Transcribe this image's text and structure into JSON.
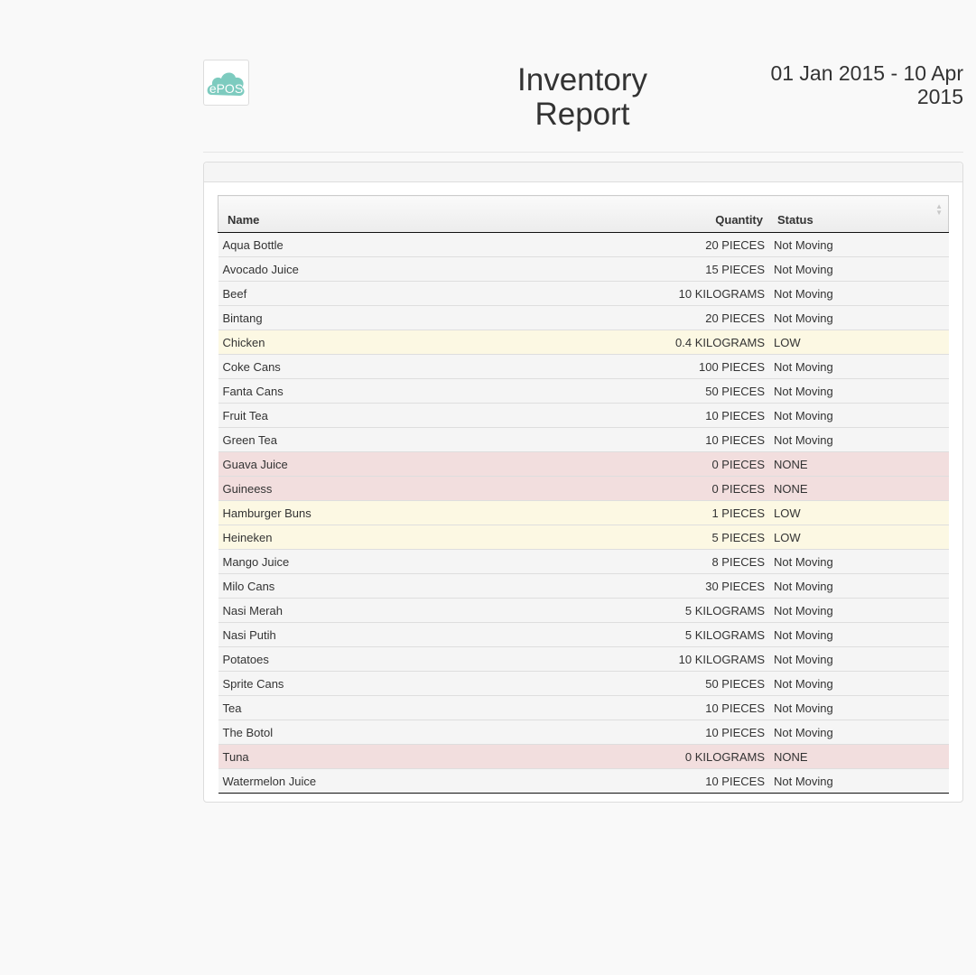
{
  "header": {
    "logo_text": "ePOS",
    "title": "Inventory Report",
    "date_range": "01 Jan 2015 - 10 Apr 2015"
  },
  "table": {
    "columns": {
      "name": "Name",
      "quantity": "Quantity",
      "status": "Status"
    },
    "sort": {
      "column": "name",
      "direction": "asc"
    },
    "rows": [
      {
        "name": "Aqua Bottle",
        "quantity": "20 PIECES",
        "status": "Not Moving",
        "level": "normal"
      },
      {
        "name": "Avocado Juice",
        "quantity": "15 PIECES",
        "status": "Not Moving",
        "level": "normal"
      },
      {
        "name": "Beef",
        "quantity": "10 KILOGRAMS",
        "status": "Not Moving",
        "level": "normal"
      },
      {
        "name": "Bintang",
        "quantity": "20 PIECES",
        "status": "Not Moving",
        "level": "normal"
      },
      {
        "name": "Chicken",
        "quantity": "0.4 KILOGRAMS",
        "status": "LOW",
        "level": "low"
      },
      {
        "name": "Coke Cans",
        "quantity": "100 PIECES",
        "status": "Not Moving",
        "level": "normal"
      },
      {
        "name": "Fanta Cans",
        "quantity": "50 PIECES",
        "status": "Not Moving",
        "level": "normal"
      },
      {
        "name": "Fruit Tea",
        "quantity": "10 PIECES",
        "status": "Not Moving",
        "level": "normal"
      },
      {
        "name": "Green Tea",
        "quantity": "10 PIECES",
        "status": "Not Moving",
        "level": "normal"
      },
      {
        "name": "Guava Juice",
        "quantity": "0 PIECES",
        "status": "NONE",
        "level": "none"
      },
      {
        "name": "Guineess",
        "quantity": "0 PIECES",
        "status": "NONE",
        "level": "none"
      },
      {
        "name": "Hamburger Buns",
        "quantity": "1 PIECES",
        "status": "LOW",
        "level": "low"
      },
      {
        "name": "Heineken",
        "quantity": "5 PIECES",
        "status": "LOW",
        "level": "low"
      },
      {
        "name": "Mango Juice",
        "quantity": "8 PIECES",
        "status": "Not Moving",
        "level": "normal"
      },
      {
        "name": "Milo Cans",
        "quantity": "30 PIECES",
        "status": "Not Moving",
        "level": "normal"
      },
      {
        "name": "Nasi Merah",
        "quantity": "5 KILOGRAMS",
        "status": "Not Moving",
        "level": "normal"
      },
      {
        "name": "Nasi Putih",
        "quantity": "5 KILOGRAMS",
        "status": "Not Moving",
        "level": "normal"
      },
      {
        "name": "Potatoes",
        "quantity": "10 KILOGRAMS",
        "status": "Not Moving",
        "level": "normal"
      },
      {
        "name": "Sprite Cans",
        "quantity": "50 PIECES",
        "status": "Not Moving",
        "level": "normal"
      },
      {
        "name": "Tea",
        "quantity": "10 PIECES",
        "status": "Not Moving",
        "level": "normal"
      },
      {
        "name": "The Botol",
        "quantity": "10 PIECES",
        "status": "Not Moving",
        "level": "normal"
      },
      {
        "name": "Tuna",
        "quantity": "0 KILOGRAMS",
        "status": "NONE",
        "level": "none"
      },
      {
        "name": "Watermelon Juice",
        "quantity": "10 PIECES",
        "status": "Not Moving",
        "level": "normal"
      }
    ]
  },
  "colors": {
    "low_row": "#fcf8e3",
    "none_row": "#f2dede",
    "normal_row": "#f5f5f5",
    "logo": "#7dcbbf",
    "sort_active": "#6b7fd7"
  },
  "icons": {
    "logo": "epos-cloud-logo",
    "sort_asc": "sort-asc-icon",
    "sort_both": "sort-both-icon"
  }
}
